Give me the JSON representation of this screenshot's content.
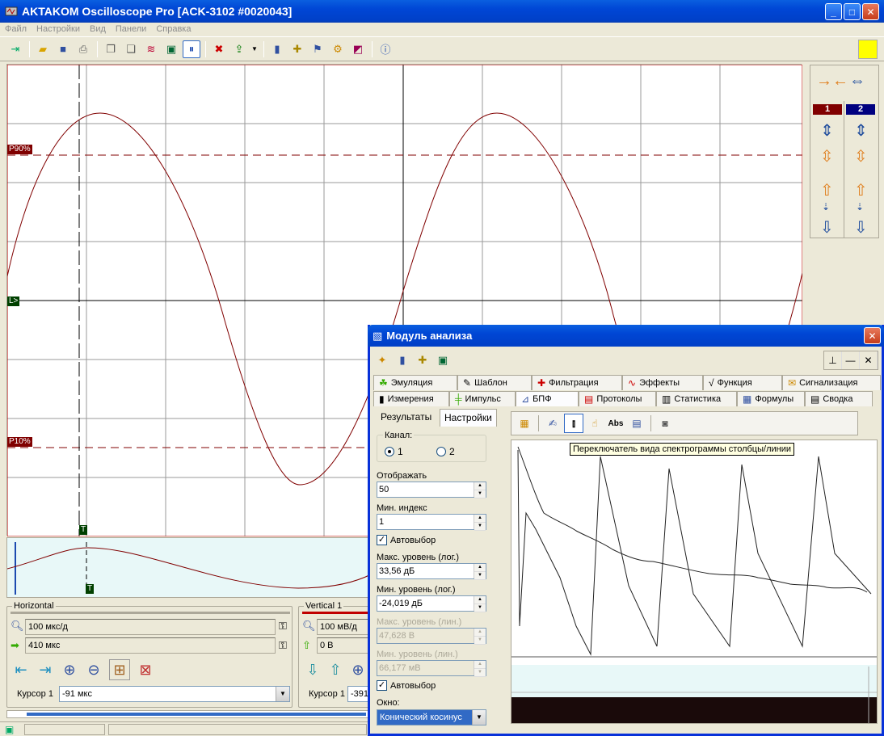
{
  "window": {
    "title": "AKTAKOM Oscilloscope Pro [ACK-3102 #0020043]"
  },
  "menu": [
    "Файл",
    "Настройки",
    "Вид",
    "Панели",
    "Справка"
  ],
  "scope": {
    "marker_p90": "P90%",
    "marker_p10": "P10%",
    "marker_level": "L>",
    "marker_trigger": "T"
  },
  "overview": {
    "marker_trigger": "T"
  },
  "channels": {
    "ch1_label": "1",
    "ch2_label": "2",
    "ch1_color": "#800000",
    "ch2_color": "#000080"
  },
  "horizontal": {
    "title": "Horizontal",
    "timebase": "100 мкс/д",
    "offset": "410 мкс",
    "cursor_label": "Курсор 1",
    "cursor_value": "-91 мкс"
  },
  "vertical": {
    "title": "Vertical 1",
    "scale": "100 мВ/д",
    "offset": "0 В",
    "cursor_label": "Курсор 1",
    "cursor_value": "-391"
  },
  "module": {
    "title": "Модуль анализа",
    "tabs_row1": [
      "Эмуляция",
      "Шаблон",
      "Фильтрация",
      "Эффекты",
      "Функция",
      "Сигнализация"
    ],
    "tabs_row2": [
      "Измерения",
      "Импульс",
      "БПФ",
      "Протоколы",
      "Статистика",
      "Формулы",
      "Сводка"
    ],
    "subtabs": [
      "Результаты",
      "Настройки"
    ],
    "settings": {
      "channel_label": "Канал:",
      "channel_options": [
        "1",
        "2"
      ],
      "display_label": "Отображать",
      "display_value": "50",
      "min_index_label": "Мин. индекс",
      "min_index_value": "1",
      "autoselect_label": "Автовыбор",
      "max_log_label": "Макс. уровень (лог.)",
      "max_log_value": "33,56 дБ",
      "min_log_label": "Мин. уровень (лог.)",
      "min_log_value": "-24,019 дБ",
      "max_lin_label": "Макс. уровень (лин.)",
      "max_lin_value": "47,628 В",
      "min_lin_label": "Мин. уровень (лин.)",
      "min_lin_value": "66,177 мВ",
      "autoselect2_label": "Автовыбор",
      "window_label": "Окно:",
      "window_value": "Конический косинус"
    },
    "fft_toolbar": {
      "abs_label": "Abs"
    },
    "tooltip": "Переключатель вида спектрограммы столбцы/линии"
  }
}
